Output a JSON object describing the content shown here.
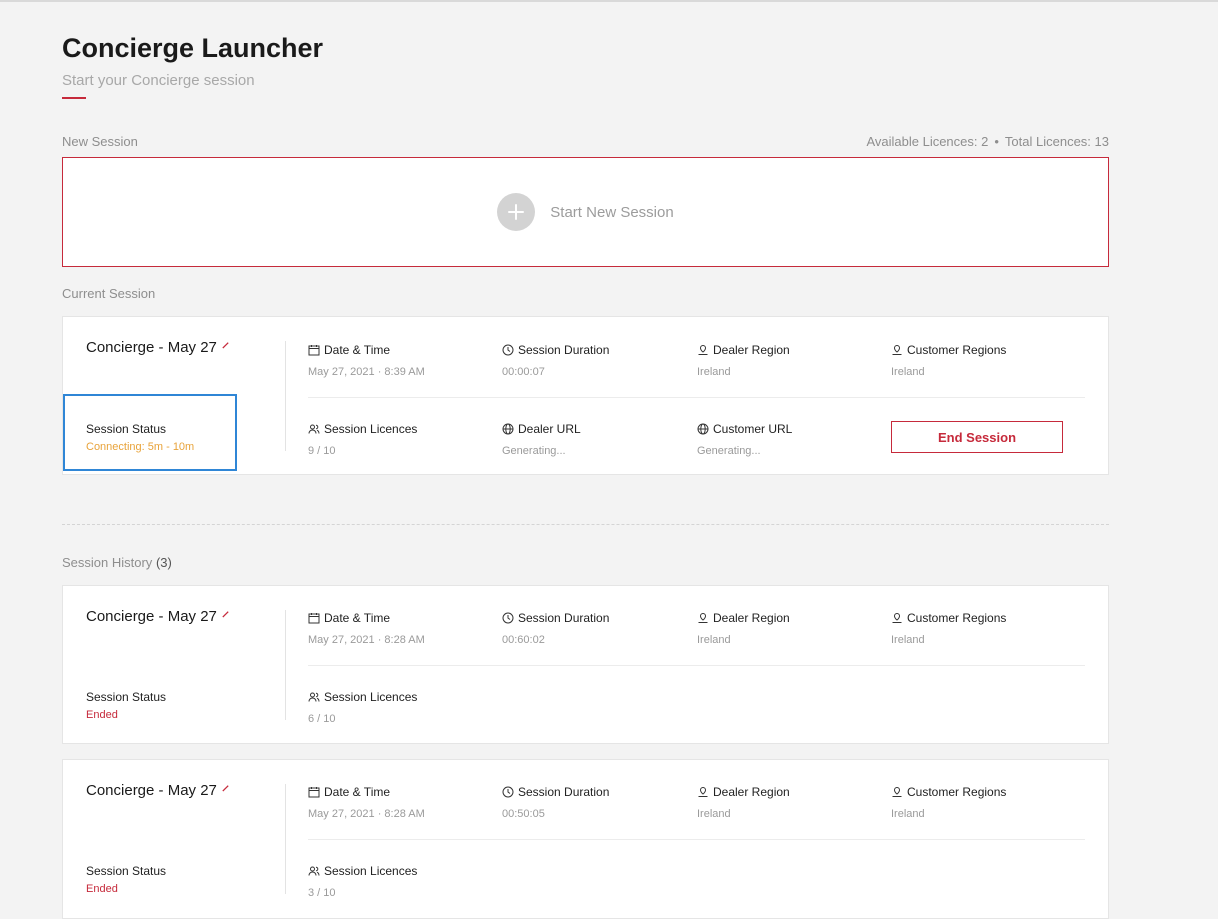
{
  "header": {
    "title": "Concierge Launcher",
    "subtitle": "Start your Concierge session"
  },
  "new_session": {
    "section_label": "New Session",
    "available_licences": "Available Licences: 2",
    "separator": "•",
    "total_licences": "Total Licences: 13",
    "start_label": "Start New Session"
  },
  "labels": {
    "date_time": "Date & Time",
    "session_duration": "Session Duration",
    "dealer_region": "Dealer Region",
    "customer_regions": "Customer Regions",
    "session_licences": "Session Licences",
    "dealer_url": "Dealer URL",
    "customer_url": "Customer URL",
    "session_status": "Session Status"
  },
  "current_session": {
    "section_label": "Current Session",
    "name": "Concierge - May 27",
    "date_time": "May 27, 2021 · 8:39 AM",
    "duration": "00:00:07",
    "dealer_region": "Ireland",
    "customer_regions": "Ireland",
    "status": "Connecting: 5m - 10m",
    "licences": "9 / 10",
    "dealer_url": "Generating...",
    "customer_url": "Generating...",
    "end_button": "End Session"
  },
  "history": {
    "section_label": "Session History",
    "count": "(3)",
    "sessions": [
      {
        "name": "Concierge - May 27",
        "date_time": "May 27, 2021 · 8:28 AM",
        "duration": "00:60:02",
        "dealer_region": "Ireland",
        "customer_regions": "Ireland",
        "status": "Ended",
        "licences": "6 / 10"
      },
      {
        "name": "Concierge - May 27",
        "date_time": "May 27, 2021 · 8:28 AM",
        "duration": "00:50:05",
        "dealer_region": "Ireland",
        "customer_regions": "Ireland",
        "status": "Ended",
        "licences": "3 / 10"
      }
    ]
  },
  "colors": {
    "accent": "#c62a3b",
    "connecting": "#e8a33a",
    "focus": "#2f86d6",
    "background": "#f3f3f3"
  }
}
